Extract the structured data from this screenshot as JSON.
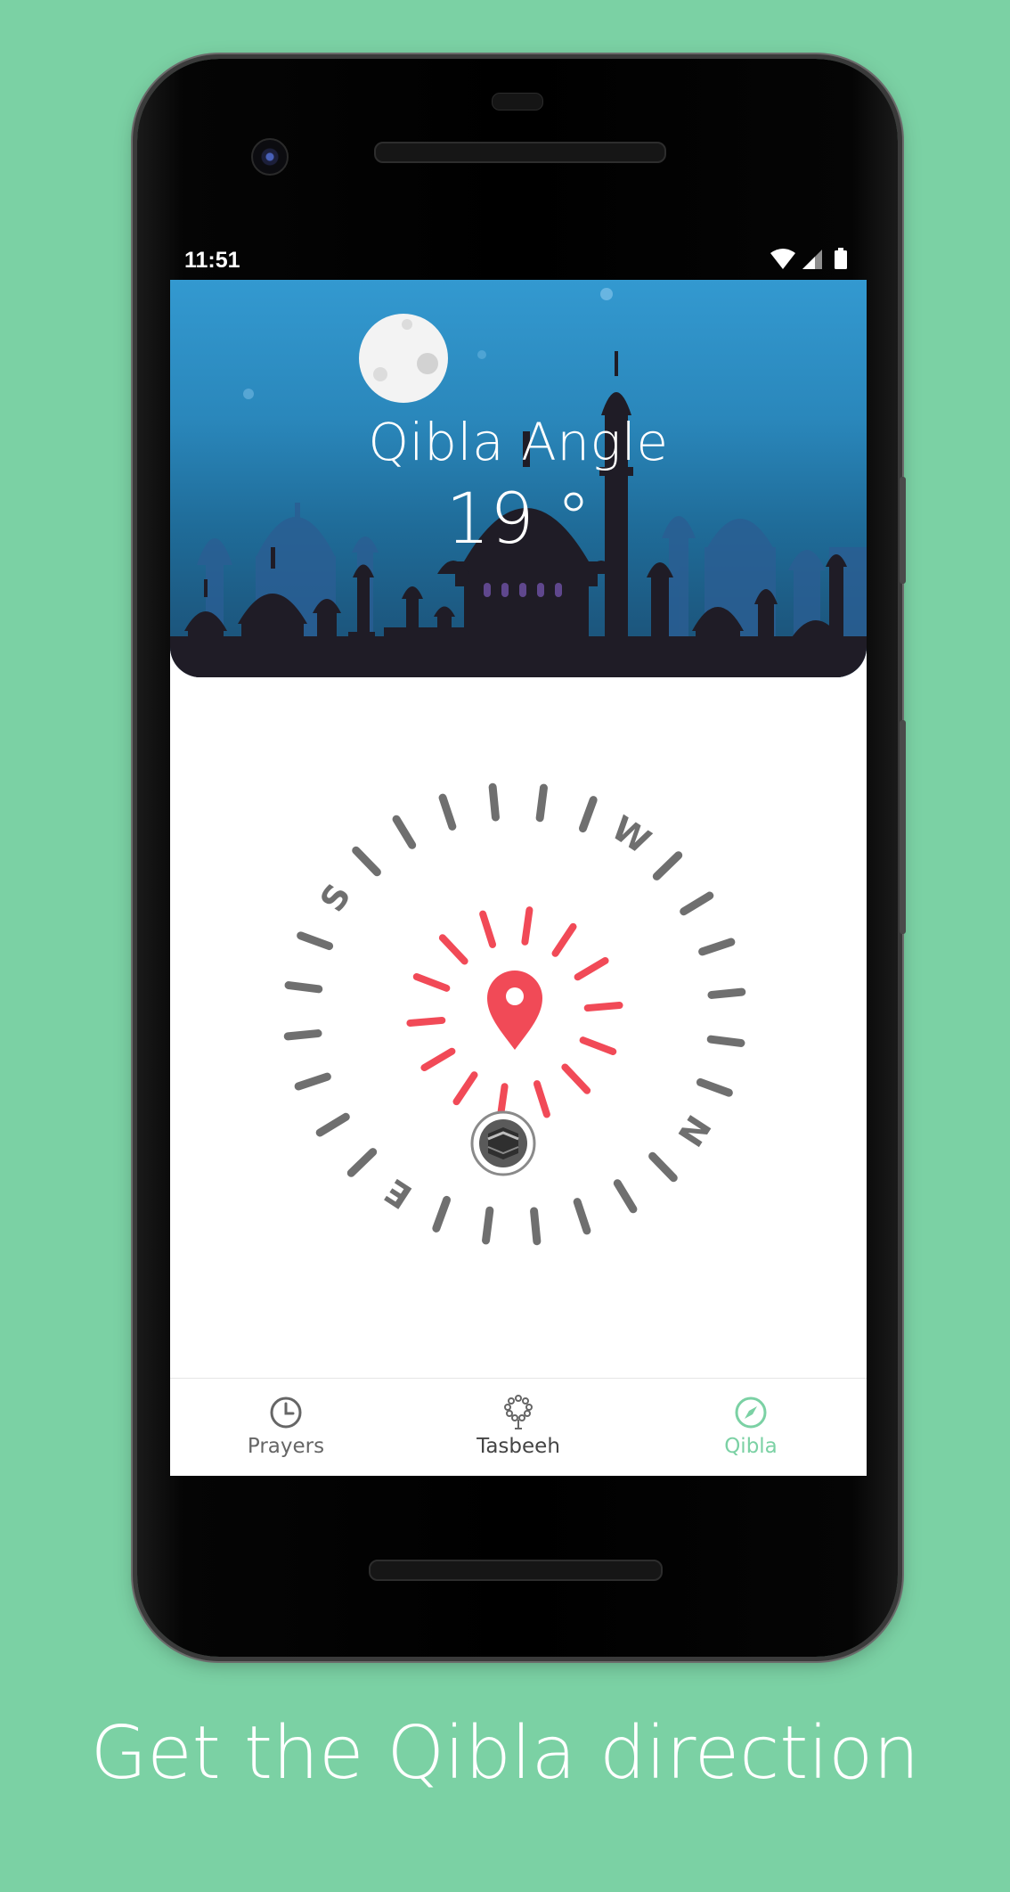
{
  "status_bar": {
    "time": "11:51",
    "icons": [
      "wifi-icon",
      "signal-icon",
      "battery-icon"
    ]
  },
  "header": {
    "title": "Qibla Angle",
    "angle": "19 °"
  },
  "compass": {
    "direction_letters": [
      "N",
      "E",
      "S",
      "W"
    ],
    "accent_color": "#f14a57",
    "tick_color": "#6f6f6f",
    "kaaba_icon": "kaaba-icon",
    "center_icon": "location-pin-icon"
  },
  "bottom_nav": {
    "items": [
      {
        "label": "Prayers",
        "icon": "clock-icon",
        "active": false
      },
      {
        "label": "Tasbeeh",
        "icon": "prayer-beads-icon",
        "active": false
      },
      {
        "label": "Qibla",
        "icon": "compass-icon",
        "active": true
      }
    ],
    "active_color": "#7bd1a4",
    "inactive_color": "#666666"
  },
  "tagline": "Get the Qibla direction",
  "colors": {
    "background": "#7bd1a4",
    "header_top": "#3399d0",
    "header_bottom": "#1b4d72"
  }
}
